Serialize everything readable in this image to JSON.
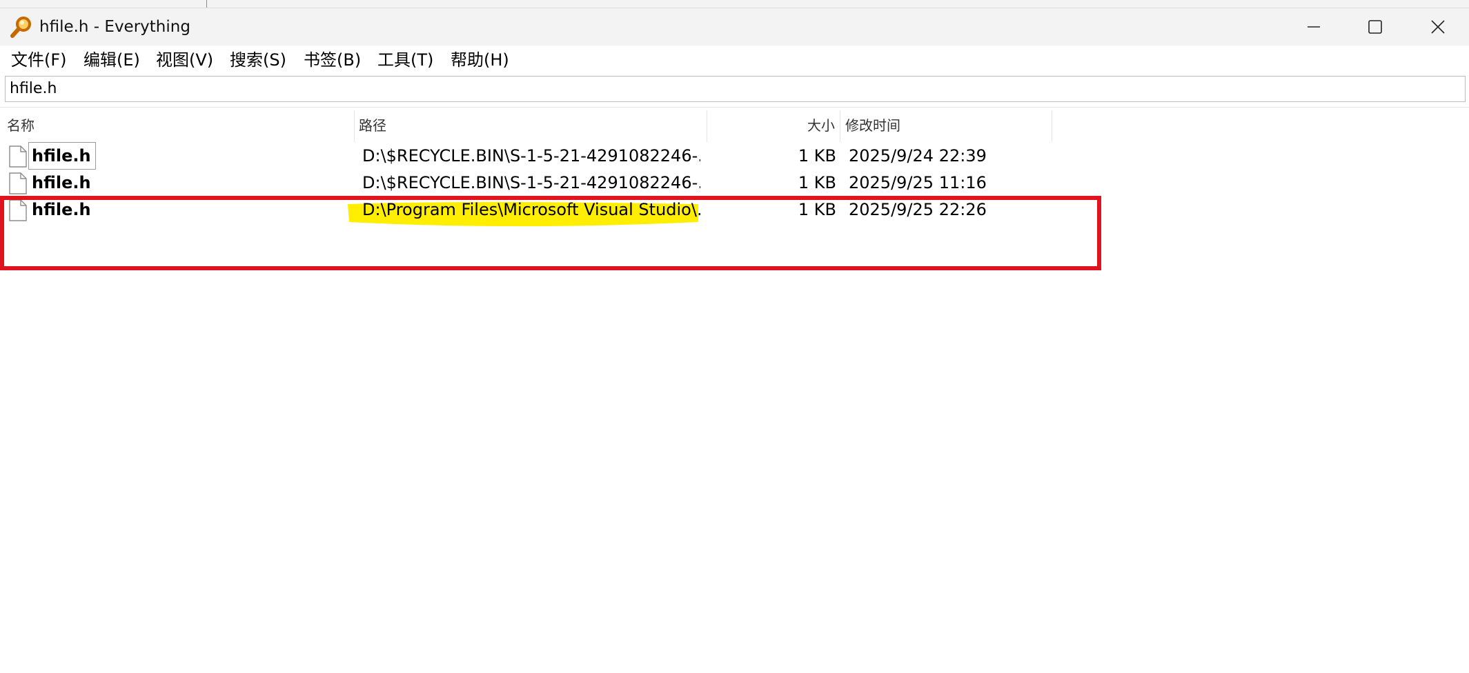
{
  "window": {
    "title": "hfile.h - Everything",
    "app_icon": "magnifier-icon",
    "controls": {
      "minimize": "minimize-icon",
      "maximize": "maximize-icon",
      "close": "close-icon"
    }
  },
  "menu": {
    "items": [
      {
        "label": "文件(F)"
      },
      {
        "label": "编辑(E)"
      },
      {
        "label": "视图(V)"
      },
      {
        "label": "搜索(S)"
      },
      {
        "label": "书签(B)"
      },
      {
        "label": "工具(T)"
      },
      {
        "label": "帮助(H)"
      }
    ]
  },
  "search": {
    "value": "hfile.h"
  },
  "columns": {
    "name": "名称",
    "path": "路径",
    "size": "大小",
    "modified": "修改时间"
  },
  "results": [
    {
      "name": "hfile.h",
      "path": "D:\\$RECYCLE.BIN\\S-1-5-21-4291082246-...",
      "size": "1 KB",
      "modified": "2025/9/24 22:39",
      "icon": "file-icon",
      "focused": true
    },
    {
      "name": "hfile.h",
      "path": "D:\\$RECYCLE.BIN\\S-1-5-21-4291082246-...",
      "size": "1 KB",
      "modified": "2025/9/25 11:16",
      "icon": "file-icon"
    },
    {
      "name": "hfile.h",
      "path": "D:\\Program Files\\Microsoft Visual Studio\\...",
      "size": "1 KB",
      "modified": "2025/9/25 22:26",
      "icon": "file-icon",
      "highlighted": true
    }
  ],
  "annotations": {
    "box_color": "#e0141e",
    "highlight_color": "#ffee00"
  }
}
